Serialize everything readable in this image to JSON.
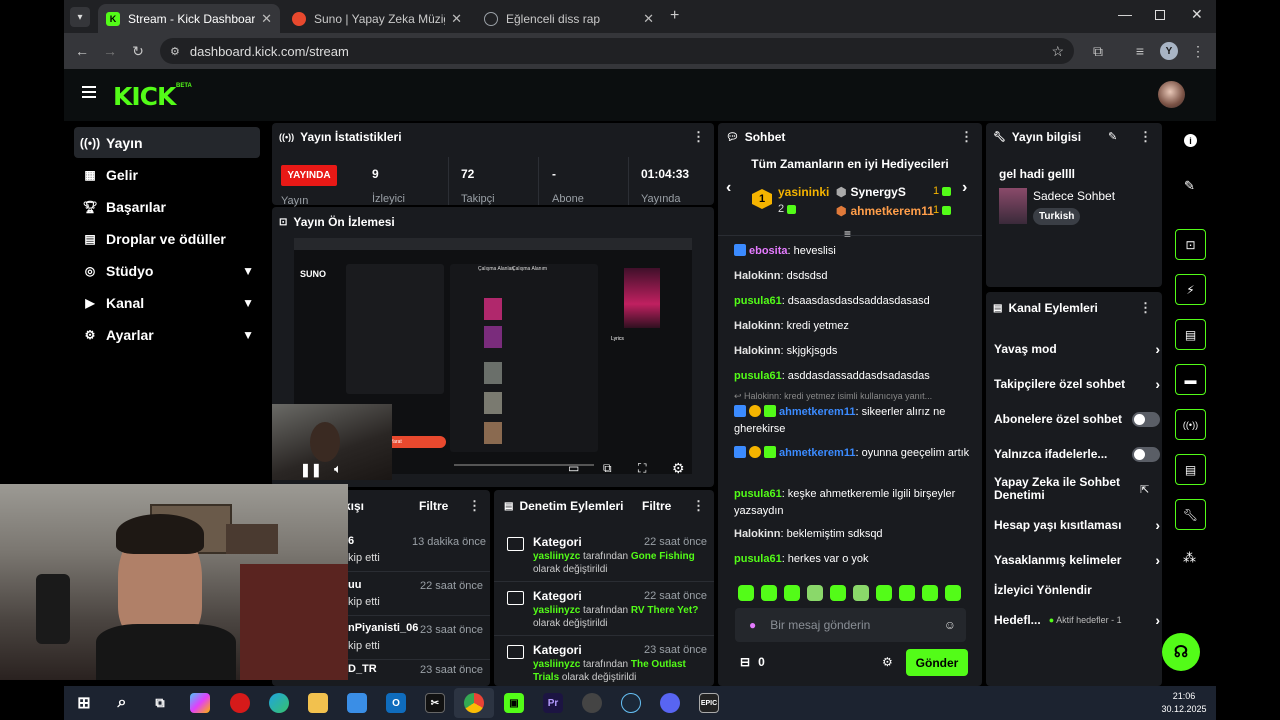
{
  "browser": {
    "tabs": [
      {
        "title": "Stream - Kick Dashboard",
        "favicon": "kick-icon",
        "favicon_color": "#53fc18"
      },
      {
        "title": "Suno | Yapay Zeka Müziği",
        "favicon": "suno-icon",
        "favicon_color": "#e8492e"
      },
      {
        "title": "Eğlenceli diss rap",
        "favicon": "globe-icon",
        "favicon_color": "#9aa0a6"
      }
    ],
    "url": "dashboard.kick.com/stream",
    "profile_initial": "Y"
  },
  "header": {
    "logo": "KICK",
    "beta": "BETA"
  },
  "sidebar": {
    "items": [
      {
        "label": "Yayın",
        "icon": "broadcast-icon",
        "selected": true
      },
      {
        "label": "Gelir",
        "icon": "revenue-icon"
      },
      {
        "label": "Başarılar",
        "icon": "trophy-icon"
      },
      {
        "label": "Droplar ve ödüller",
        "icon": "gift-icon"
      },
      {
        "label": "Stüdyo",
        "icon": "studio-icon",
        "expandable": true
      },
      {
        "label": "Kanal",
        "icon": "channel-icon",
        "expandable": true
      },
      {
        "label": "Ayarlar",
        "icon": "settings-icon",
        "expandable": true
      }
    ]
  },
  "stats": {
    "title": "Yayın İstatistikleri",
    "live_badge": "YAYINDA",
    "live_label": "Yayın",
    "items": [
      {
        "value": "9",
        "label": "İzleyici"
      },
      {
        "value": "72",
        "label": "Takipçi"
      },
      {
        "value": "-",
        "label": "Abone"
      },
      {
        "value": "01:04:33",
        "label": "Yayında"
      }
    ]
  },
  "preview": {
    "title": "Yayın Ön İzlemesi",
    "inner": {
      "logo": "SUNO",
      "header": "Çalışma Alanları",
      "workspace": "Çalışma Alanım",
      "button": "Yarat",
      "song": "Lyrics"
    }
  },
  "followers": {
    "title": "kışı",
    "filter": "Filtre",
    "rows": [
      {
        "name": "6",
        "action": "kip etti",
        "time": "13 dakika önce"
      },
      {
        "name": "uu",
        "action": "kip etti",
        "time": "22 saat önce"
      },
      {
        "name": "nPiyanisti_06",
        "action": "kip etti",
        "time": "23 saat önce"
      },
      {
        "name": "D_TR",
        "action": "",
        "time": "23 saat önce"
      }
    ]
  },
  "moderation": {
    "title": "Denetim Eylemleri",
    "filter": "Filtre",
    "items": [
      {
        "label": "Kategori",
        "time": "22 saat önce",
        "user": "yasliinyzc",
        "mid": " tarafından ",
        "target": "Gone Fishing",
        "suffix": "olarak değiştirildi"
      },
      {
        "label": "Kategori",
        "time": "22 saat önce",
        "user": "yasliinyzc",
        "mid": " tarafından ",
        "target": "RV There Yet?",
        "suffix": "olarak değiştirildi"
      },
      {
        "label": "Kategori",
        "time": "23 saat önce",
        "user": "yasliinyzc",
        "mid": " tarafından ",
        "target": "The Outlast Trials",
        "suffix": "olarak değiştirildi"
      }
    ]
  },
  "chat": {
    "title": "Sohbet",
    "gifters_title": "Tüm Zamanların en iyi Hediyecileri",
    "gifters": [
      {
        "rank": "1",
        "name": "yasininki",
        "count": "2"
      },
      {
        "name": "SynergyS",
        "count": "1"
      },
      {
        "name": "ahmetkerem11",
        "count": "1"
      }
    ],
    "messages": [
      {
        "user": "ebosita",
        "text": " heveslisi",
        "color": "m",
        "badges": [
          "verified"
        ]
      },
      {
        "user": "Halokinn",
        "text": " dsdsdsd",
        "color": "p"
      },
      {
        "user": "pusula61",
        "text": " dsaasdasdasdsaddasdasasd",
        "color": "g"
      },
      {
        "user": "Halokinn",
        "text": " kredi yetmez",
        "color": "p"
      },
      {
        "user": "Halokinn",
        "text": " skjgkjsgds",
        "color": "p"
      },
      {
        "user": "pusula61",
        "text": " asddasdassaddasdsadasdas",
        "color": "g"
      }
    ],
    "reply_hint": "Halokinn: kredi yetmez isimli kullanıcıya yanıt...",
    "messages2": [
      {
        "user": "ahmetkerem11",
        "text": " sikeerler alırız ne gherekirse",
        "color": "b"
      },
      {
        "user": "ahmetkerem11",
        "text": " oyunna geeçelim artık",
        "color": "b"
      },
      {
        "user": "pusula61",
        "text": " keşke ahmetkeremle ilgili birşeyler yazsaydın",
        "color": "g"
      },
      {
        "user": "Halokinn",
        "text": " beklemiştim sdksqd",
        "color": "p"
      },
      {
        "user": "pusula61",
        "text": " herkes var o yok",
        "color": "g"
      }
    ],
    "input_placeholder": "Bir mesaj gönderin",
    "points": "0",
    "send": "Gönder"
  },
  "stream_info": {
    "title": "Yayın bilgisi",
    "stream_title": "gel hadi gellll",
    "category": "Sadece Sohbet",
    "tag": "Turkish"
  },
  "channel_actions": {
    "title": "Kanal Eylemleri",
    "items": [
      {
        "label": "Yavaş mod",
        "type": "arrow"
      },
      {
        "label": "Takipçilere özel sohbet",
        "type": "arrow"
      },
      {
        "label": "Abonelere özel sohbet",
        "type": "toggle"
      },
      {
        "label": "Yalnızca ifadelerle...",
        "type": "toggle"
      },
      {
        "label": "Yapay Zeka ile Sohbet Denetimi",
        "type": "external"
      },
      {
        "label": "Hesap yaşı kısıtlaması",
        "type": "arrow"
      },
      {
        "label": "Yasaklanmış kelimeler",
        "type": "arrow"
      },
      {
        "label": "İzleyici Yönlendir",
        "type": "none"
      },
      {
        "label": "Hedefl...",
        "type": "arrow",
        "status": "Aktif hedefler - 1"
      }
    ]
  },
  "taskbar": {
    "time": "21:06",
    "date": "30.12.2025"
  },
  "colors": {
    "accent": "#53fc18",
    "panel": "#191b1f",
    "bg": "#000000"
  }
}
